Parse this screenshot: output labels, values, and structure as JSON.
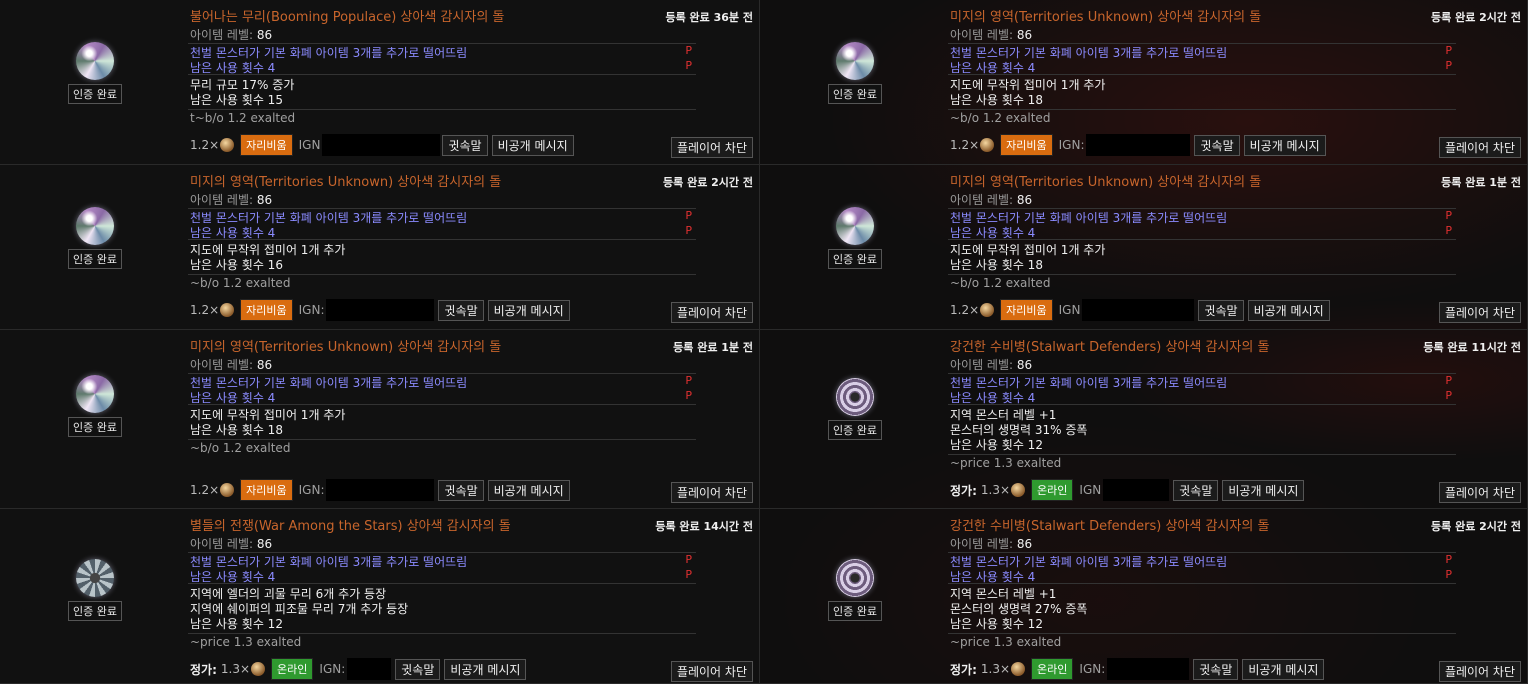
{
  "common": {
    "verified": "인증 완료",
    "ilvl_label": "아이템 레벨:",
    "afk": "자리비움",
    "online": "온라인",
    "ign": "IGN:",
    "ign_nocolon": "IGN",
    "whisper": "귓속말",
    "pm": "비공개 메시지",
    "block": "플레이어 차단",
    "price_label": "정가:",
    "p_mark": "P",
    "implicit1": "천벌 몬스터가 기본 화폐 아이템 3개를 추가로 떨어뜨림",
    "implicit2": "남은 사용 횟수 4"
  },
  "colors": {
    "title": "#c8652c",
    "implicit": "#8b8bff",
    "afk": "#d96c10",
    "online": "#2f9a2f",
    "p_mark": "#e03030"
  },
  "listings": [
    {
      "title": "불어나는 무리(Booming Populace) 상아색 감시자의 돌",
      "listed": "등록 완료 36분 전",
      "ilvl": "86",
      "icon": "watchstone-icon",
      "explicit": [
        "무리 규모 17% 증가",
        "남은 사용 횟수 15"
      ],
      "note": "t~b/o 1.2 exalted",
      "price": "1.2×",
      "status": "afk",
      "ign_text": "IGN"
    },
    {
      "title": "미지의 영역(Territories Unknown) 상아색 감시자의 돌",
      "listed": "등록 완료 2시간 전",
      "ilvl": "86",
      "icon": "watchstone-icon",
      "explicit": [
        "지도에 무작위 접미어 1개 추가",
        "남은 사용 횟수 18"
      ],
      "note": "~b/o 1.2 exalted",
      "price": "1.2×",
      "status": "afk",
      "ign_text": "IGN:"
    },
    {
      "title": "미지의 영역(Territories Unknown) 상아색 감시자의 돌",
      "listed": "등록 완료 2시간 전",
      "ilvl": "86",
      "icon": "watchstone-icon",
      "explicit": [
        "지도에 무작위 접미어 1개 추가",
        "남은 사용 횟수 16"
      ],
      "note": "~b/o 1.2 exalted",
      "price": "1.2×",
      "status": "afk",
      "ign_text": "IGN:"
    },
    {
      "title": "미지의 영역(Territories Unknown) 상아색 감시자의 돌",
      "listed": "등록 완료 1분 전",
      "ilvl": "86",
      "icon": "watchstone-icon",
      "explicit": [
        "지도에 무작위 접미어 1개 추가",
        "남은 사용 횟수 18"
      ],
      "note": "~b/o 1.2 exalted",
      "price": "1.2×",
      "status": "afk",
      "ign_text": "IGN"
    },
    {
      "title": "미지의 영역(Territories Unknown) 상아색 감시자의 돌",
      "listed": "등록 완료 1분 전",
      "ilvl": "86",
      "icon": "watchstone-icon",
      "explicit": [
        "지도에 무작위 접미어 1개 추가",
        "남은 사용 횟수 18"
      ],
      "note": "~b/o 1.2 exalted",
      "price": "1.2×",
      "status": "afk",
      "ign_text": "IGN:"
    },
    {
      "title": "강건한 수비병(Stalwart Defenders) 상아색 감시자의 돌",
      "listed": "등록 완료 11시간 전",
      "ilvl": "86",
      "icon": "watchstone-icon",
      "explicit": [
        "지역 몬스터 레벨 +1",
        "몬스터의 생명력 31% 증폭",
        "남은 사용 횟수 12"
      ],
      "note": "~price 1.3 exalted",
      "price": "1.3×",
      "status": "online",
      "ign_text": "IGN",
      "price_label": true
    },
    {
      "title": "별들의 전쟁(War Among the Stars) 상아색 감시자의 돌",
      "listed": "등록 완료 14시간 전",
      "ilvl": "86",
      "icon": "watchstone-icon",
      "explicit": [
        "지역에 엘더의 괴물 무리 6개 추가 등장",
        "지역에 쉐이퍼의 피조물 무리 7개 추가 등장",
        "남은 사용 횟수 12"
      ],
      "note": "~price 1.3 exalted",
      "price": "1.3×",
      "status": "online",
      "ign_text": "IGN:",
      "price_label": true
    },
    {
      "title": "강건한 수비병(Stalwart Defenders) 상아색 감시자의 돌",
      "listed": "등록 완료 2시간 전",
      "ilvl": "86",
      "icon": "watchstone-icon",
      "explicit": [
        "지역 몬스터 레벨 +1",
        "몬스터의 생명력 27% 증폭",
        "남은 사용 횟수 12"
      ],
      "note": "~price 1.3 exalted",
      "price": "1.3×",
      "status": "online",
      "ign_text": "IGN:",
      "price_label": true
    }
  ]
}
